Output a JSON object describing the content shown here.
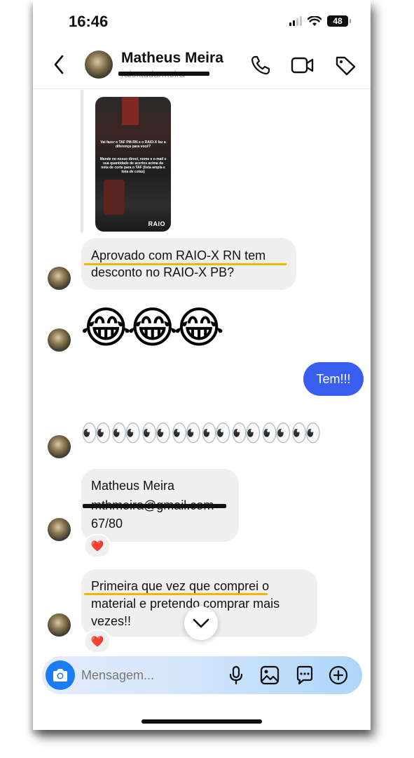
{
  "status_bar": {
    "time": "16:46",
    "battery": "48"
  },
  "header": {
    "name": "Matheus Meira",
    "username": "raioxtudarmeira"
  },
  "story_reply": {
    "story_text_1": "Vai fazer o TAF PM-RN e o RAIO-X faz a diferença para você?",
    "story_text_2": "Mande no nosso direct, nome e e-mail e sua quantidade de acertos acima da nota de corte para o TAF (lista ampla e lista de cotas)",
    "story_brand": "RAIO"
  },
  "messages": {
    "m1_line1": "Aprovado com RAIO-X RN tem",
    "m1_line2": "desconto no RAIO-X PB?",
    "m2_emojis": "😂😂😂",
    "m3_outgoing": "Tem!!!",
    "m4_emojis": "👀👀👀👀👀👀👀👀",
    "m5_line1": "Matheus Meira",
    "m5_line2": "mthmeira@gmail.com",
    "m5_line3": "67/80",
    "m5_reaction": "❤️",
    "m6_line1": "Primeira que vez que comprei o",
    "m6_line2": "material e pretendo comprar mais",
    "m6_line3": "vezes!!",
    "m6_reaction": "❤️"
  },
  "composer": {
    "placeholder": "Mensagem..."
  },
  "colors": {
    "accent": "#3a5ff0",
    "highlight": "#f3b600",
    "camera": "#1a7cf2",
    "heart": "#e0152e"
  },
  "icons": [
    "back-icon",
    "phone-icon",
    "video-icon",
    "tag-icon",
    "camera-icon",
    "microphone-icon",
    "gallery-icon",
    "sticker-icon",
    "plus-icon",
    "chevron-down-icon"
  ]
}
